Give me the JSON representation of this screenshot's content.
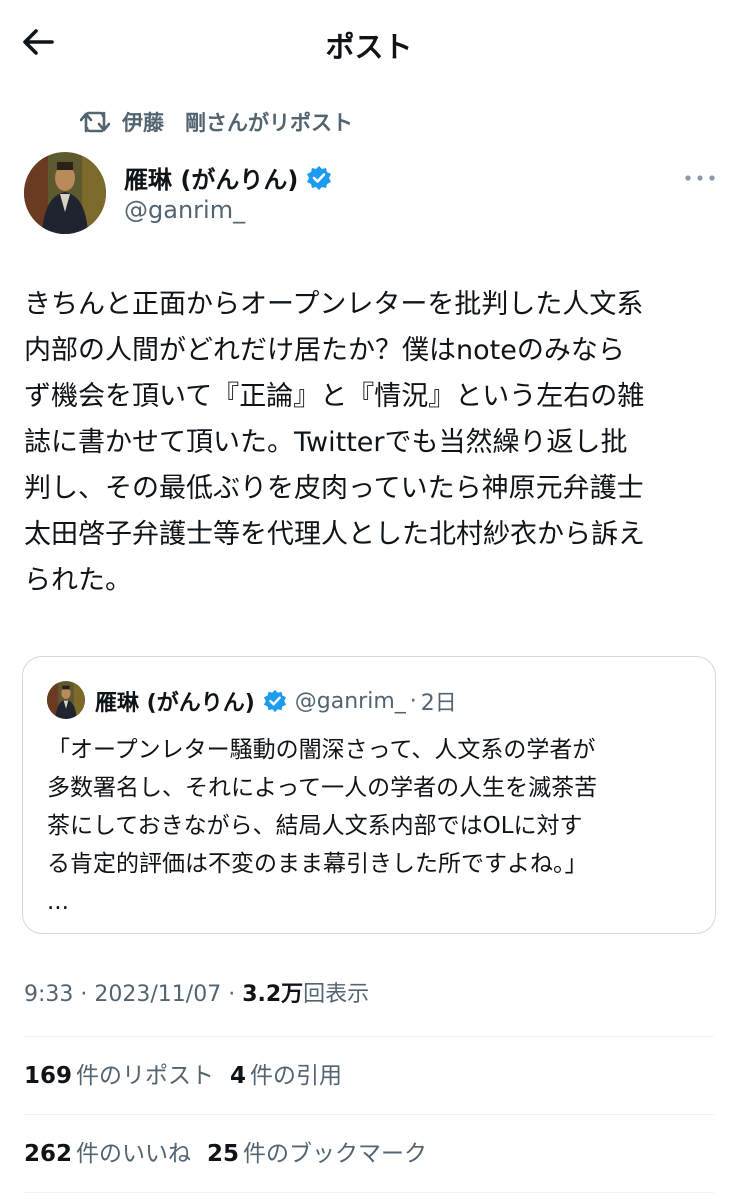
{
  "header": {
    "title": "ポスト"
  },
  "repost": {
    "text": "伊藤　剛さんがリポスト"
  },
  "author": {
    "name": "雁琳 (がんりん)",
    "handle": "@ganrim_"
  },
  "tweet": {
    "lines": [
      "きちんと正面からオープンレターを批判した人文系",
      "内部の人間がどれだけ居たか？僕はnoteのみなら",
      "ず機会を頂いて『正論』と『情況』という左右の雑",
      "誌に書かせて頂いた。Twitterでも当然繰り返し批",
      "判し、その最低ぶりを皮肉っていたら神原元弁護士",
      "太田啓子弁護士等を代理人とした北村紗衣から訴え",
      "られた。"
    ]
  },
  "quote": {
    "name": "雁琳 (がんりん)",
    "handle": "@ganrim_",
    "dot": "·",
    "time": "2日",
    "lines": [
      "「オープンレター騒動の闇深さって、人文系の学者が",
      "多数署名し、それによって一人の学者の人生を滅茶苦",
      "茶にしておきながら、結局人文系内部ではOLに対す",
      "る肯定的評価は不変のまま幕引きした所ですよね。」"
    ],
    "ellipsis": "..."
  },
  "meta": {
    "time": "9:33",
    "sep1": " · ",
    "date": "2023/11/07",
    "sep2": " · ",
    "views": "3.2万",
    "views_label": "回表示"
  },
  "stats": {
    "reposts": {
      "num": "169",
      "label": "件のリポスト"
    },
    "quotes": {
      "num": "4",
      "label": "件の引用"
    },
    "likes": {
      "num": "262",
      "label": "件のいいね"
    },
    "bookmarks": {
      "num": "25",
      "label": "件のブックマーク"
    }
  },
  "colors": {
    "verified": "#1d9bf0",
    "secondary_text": "#536471",
    "divider": "#eff3f4"
  },
  "icons": {
    "back": "arrow-left-icon",
    "repost": "repost-icon",
    "verified": "verified-badge-icon",
    "more": "more-horizontal-icon"
  }
}
